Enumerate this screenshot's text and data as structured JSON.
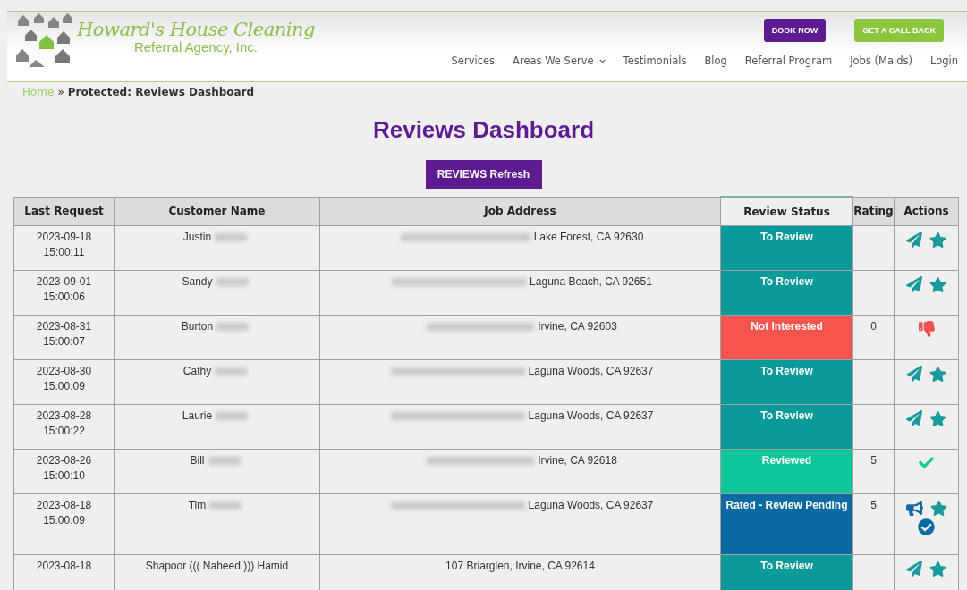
{
  "header": {
    "logo": {
      "title": "Howard's House Cleaning",
      "subtitle": "Referral Agency, Inc."
    },
    "buttons": [
      {
        "label": "BOOK NOW",
        "kind": "primary"
      },
      {
        "label": "GET A CALL BACK",
        "kind": "secondary"
      }
    ],
    "nav": [
      {
        "label": "Services",
        "dropdown": false
      },
      {
        "label": "Areas We Serve",
        "dropdown": true
      },
      {
        "label": "Testimonials",
        "dropdown": false
      },
      {
        "label": "Blog",
        "dropdown": false
      },
      {
        "label": "Referral Program",
        "dropdown": false
      },
      {
        "label": "Jobs (Maids)",
        "dropdown": false
      },
      {
        "label": "Login",
        "dropdown": false
      }
    ]
  },
  "breadcrumb": {
    "link": "Home",
    "separator": "»",
    "current": "Protected: Reviews Dashboard"
  },
  "title": "Reviews Dashboard",
  "refresh_button": "REVIEWS Refresh",
  "table": {
    "columns": [
      "Last Request",
      "Customer Name",
      "Job Address",
      "Review Status",
      "Rating",
      "Actions"
    ],
    "rows": [
      {
        "date": "2023-09-18",
        "time": "15:00:11",
        "name": "Justin",
        "name_hidden": true,
        "address": "Lake Forest, CA 92630",
        "address_hidden": true,
        "status": {
          "label": "To Review",
          "kind": "to_review"
        },
        "rating": "",
        "actions": [
          {
            "kind": "send"
          },
          {
            "kind": "star"
          }
        ]
      },
      {
        "date": "2023-09-01",
        "time": "15:00:06",
        "name": "Sandy",
        "name_hidden": true,
        "address": "Laguna Beach, CA 92651",
        "address_hidden": true,
        "status": {
          "label": "To Review",
          "kind": "to_review"
        },
        "rating": "",
        "actions": [
          {
            "kind": "send"
          },
          {
            "kind": "star"
          }
        ]
      },
      {
        "date": "2023-08-31",
        "time": "15:00:07",
        "name": "Burton",
        "name_hidden": true,
        "address": "Irvine, CA 92603",
        "address_hidden": true,
        "status": {
          "label": "Not Interested",
          "kind": "not_interested"
        },
        "rating": "0",
        "actions": [
          {
            "kind": "thumbs_down"
          }
        ]
      },
      {
        "date": "2023-08-30",
        "time": "15:00:09",
        "name": "Cathy",
        "name_hidden": true,
        "address": "Laguna Woods, CA 92637",
        "address_hidden": true,
        "status": {
          "label": "To Review",
          "kind": "to_review"
        },
        "rating": "",
        "actions": [
          {
            "kind": "send"
          },
          {
            "kind": "star"
          }
        ]
      },
      {
        "date": "2023-08-28",
        "time": "15:00:22",
        "name": "Laurie",
        "name_hidden": true,
        "address": "Laguna Woods, CA 92637",
        "address_hidden": true,
        "status": {
          "label": "To Review",
          "kind": "to_review"
        },
        "rating": "",
        "actions": [
          {
            "kind": "send"
          },
          {
            "kind": "star"
          }
        ]
      },
      {
        "date": "2023-08-26",
        "time": "15:00:10",
        "name": "Bill",
        "name_hidden": true,
        "address": "Irvine, CA 92618",
        "address_hidden": true,
        "status": {
          "label": "Reviewed",
          "kind": "reviewed"
        },
        "rating": "5",
        "actions": [
          {
            "kind": "check"
          }
        ]
      },
      {
        "date": "2023-08-18",
        "time": "15:00:09",
        "name": "Tim",
        "name_hidden": true,
        "address": "Laguna Woods, CA 92637",
        "address_hidden": true,
        "status": {
          "label": "Rated - Review Pending",
          "kind": "rated_pending"
        },
        "rating": "5",
        "actions": [
          {
            "kind": "megaphone"
          },
          {
            "kind": "star"
          },
          {
            "kind": "check_circle"
          }
        ]
      },
      {
        "date": "2023-08-18",
        "name": "Shapoor ((( Naheed ))) Hamid",
        "name_hidden": false,
        "address": "107 Briarglen, Irvine, CA 92614",
        "address_hidden": false,
        "status": {
          "label": "To Review",
          "kind": "to_review"
        },
        "rating": "",
        "actions": [
          {
            "kind": "send"
          },
          {
            "kind": "star"
          }
        ]
      }
    ]
  }
}
